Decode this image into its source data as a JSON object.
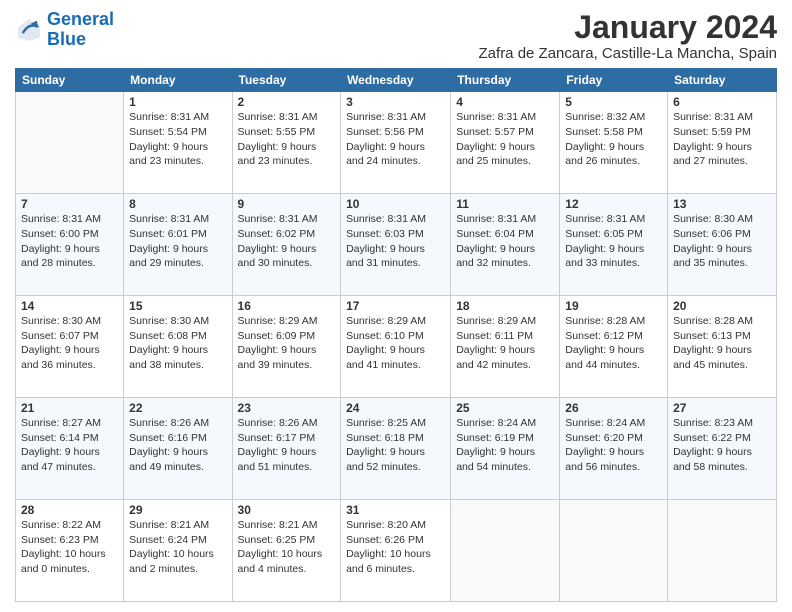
{
  "logo": {
    "line1": "General",
    "line2": "Blue"
  },
  "title": "January 2024",
  "subtitle": "Zafra de Zancara, Castille-La Mancha, Spain",
  "days_of_week": [
    "Sunday",
    "Monday",
    "Tuesday",
    "Wednesday",
    "Thursday",
    "Friday",
    "Saturday"
  ],
  "weeks": [
    [
      {
        "day": "",
        "sunrise": "",
        "sunset": "",
        "daylight": ""
      },
      {
        "day": "1",
        "sunrise": "Sunrise: 8:31 AM",
        "sunset": "Sunset: 5:54 PM",
        "daylight": "Daylight: 9 hours and 23 minutes."
      },
      {
        "day": "2",
        "sunrise": "Sunrise: 8:31 AM",
        "sunset": "Sunset: 5:55 PM",
        "daylight": "Daylight: 9 hours and 23 minutes."
      },
      {
        "day": "3",
        "sunrise": "Sunrise: 8:31 AM",
        "sunset": "Sunset: 5:56 PM",
        "daylight": "Daylight: 9 hours and 24 minutes."
      },
      {
        "day": "4",
        "sunrise": "Sunrise: 8:31 AM",
        "sunset": "Sunset: 5:57 PM",
        "daylight": "Daylight: 9 hours and 25 minutes."
      },
      {
        "day": "5",
        "sunrise": "Sunrise: 8:32 AM",
        "sunset": "Sunset: 5:58 PM",
        "daylight": "Daylight: 9 hours and 26 minutes."
      },
      {
        "day": "6",
        "sunrise": "Sunrise: 8:31 AM",
        "sunset": "Sunset: 5:59 PM",
        "daylight": "Daylight: 9 hours and 27 minutes."
      }
    ],
    [
      {
        "day": "7",
        "sunrise": "Sunrise: 8:31 AM",
        "sunset": "Sunset: 6:00 PM",
        "daylight": "Daylight: 9 hours and 28 minutes."
      },
      {
        "day": "8",
        "sunrise": "Sunrise: 8:31 AM",
        "sunset": "Sunset: 6:01 PM",
        "daylight": "Daylight: 9 hours and 29 minutes."
      },
      {
        "day": "9",
        "sunrise": "Sunrise: 8:31 AM",
        "sunset": "Sunset: 6:02 PM",
        "daylight": "Daylight: 9 hours and 30 minutes."
      },
      {
        "day": "10",
        "sunrise": "Sunrise: 8:31 AM",
        "sunset": "Sunset: 6:03 PM",
        "daylight": "Daylight: 9 hours and 31 minutes."
      },
      {
        "day": "11",
        "sunrise": "Sunrise: 8:31 AM",
        "sunset": "Sunset: 6:04 PM",
        "daylight": "Daylight: 9 hours and 32 minutes."
      },
      {
        "day": "12",
        "sunrise": "Sunrise: 8:31 AM",
        "sunset": "Sunset: 6:05 PM",
        "daylight": "Daylight: 9 hours and 33 minutes."
      },
      {
        "day": "13",
        "sunrise": "Sunrise: 8:30 AM",
        "sunset": "Sunset: 6:06 PM",
        "daylight": "Daylight: 9 hours and 35 minutes."
      }
    ],
    [
      {
        "day": "14",
        "sunrise": "Sunrise: 8:30 AM",
        "sunset": "Sunset: 6:07 PM",
        "daylight": "Daylight: 9 hours and 36 minutes."
      },
      {
        "day": "15",
        "sunrise": "Sunrise: 8:30 AM",
        "sunset": "Sunset: 6:08 PM",
        "daylight": "Daylight: 9 hours and 38 minutes."
      },
      {
        "day": "16",
        "sunrise": "Sunrise: 8:29 AM",
        "sunset": "Sunset: 6:09 PM",
        "daylight": "Daylight: 9 hours and 39 minutes."
      },
      {
        "day": "17",
        "sunrise": "Sunrise: 8:29 AM",
        "sunset": "Sunset: 6:10 PM",
        "daylight": "Daylight: 9 hours and 41 minutes."
      },
      {
        "day": "18",
        "sunrise": "Sunrise: 8:29 AM",
        "sunset": "Sunset: 6:11 PM",
        "daylight": "Daylight: 9 hours and 42 minutes."
      },
      {
        "day": "19",
        "sunrise": "Sunrise: 8:28 AM",
        "sunset": "Sunset: 6:12 PM",
        "daylight": "Daylight: 9 hours and 44 minutes."
      },
      {
        "day": "20",
        "sunrise": "Sunrise: 8:28 AM",
        "sunset": "Sunset: 6:13 PM",
        "daylight": "Daylight: 9 hours and 45 minutes."
      }
    ],
    [
      {
        "day": "21",
        "sunrise": "Sunrise: 8:27 AM",
        "sunset": "Sunset: 6:14 PM",
        "daylight": "Daylight: 9 hours and 47 minutes."
      },
      {
        "day": "22",
        "sunrise": "Sunrise: 8:26 AM",
        "sunset": "Sunset: 6:16 PM",
        "daylight": "Daylight: 9 hours and 49 minutes."
      },
      {
        "day": "23",
        "sunrise": "Sunrise: 8:26 AM",
        "sunset": "Sunset: 6:17 PM",
        "daylight": "Daylight: 9 hours and 51 minutes."
      },
      {
        "day": "24",
        "sunrise": "Sunrise: 8:25 AM",
        "sunset": "Sunset: 6:18 PM",
        "daylight": "Daylight: 9 hours and 52 minutes."
      },
      {
        "day": "25",
        "sunrise": "Sunrise: 8:24 AM",
        "sunset": "Sunset: 6:19 PM",
        "daylight": "Daylight: 9 hours and 54 minutes."
      },
      {
        "day": "26",
        "sunrise": "Sunrise: 8:24 AM",
        "sunset": "Sunset: 6:20 PM",
        "daylight": "Daylight: 9 hours and 56 minutes."
      },
      {
        "day": "27",
        "sunrise": "Sunrise: 8:23 AM",
        "sunset": "Sunset: 6:22 PM",
        "daylight": "Daylight: 9 hours and 58 minutes."
      }
    ],
    [
      {
        "day": "28",
        "sunrise": "Sunrise: 8:22 AM",
        "sunset": "Sunset: 6:23 PM",
        "daylight": "Daylight: 10 hours and 0 minutes."
      },
      {
        "day": "29",
        "sunrise": "Sunrise: 8:21 AM",
        "sunset": "Sunset: 6:24 PM",
        "daylight": "Daylight: 10 hours and 2 minutes."
      },
      {
        "day": "30",
        "sunrise": "Sunrise: 8:21 AM",
        "sunset": "Sunset: 6:25 PM",
        "daylight": "Daylight: 10 hours and 4 minutes."
      },
      {
        "day": "31",
        "sunrise": "Sunrise: 8:20 AM",
        "sunset": "Sunset: 6:26 PM",
        "daylight": "Daylight: 10 hours and 6 minutes."
      },
      {
        "day": "",
        "sunrise": "",
        "sunset": "",
        "daylight": ""
      },
      {
        "day": "",
        "sunrise": "",
        "sunset": "",
        "daylight": ""
      },
      {
        "day": "",
        "sunrise": "",
        "sunset": "",
        "daylight": ""
      }
    ]
  ]
}
